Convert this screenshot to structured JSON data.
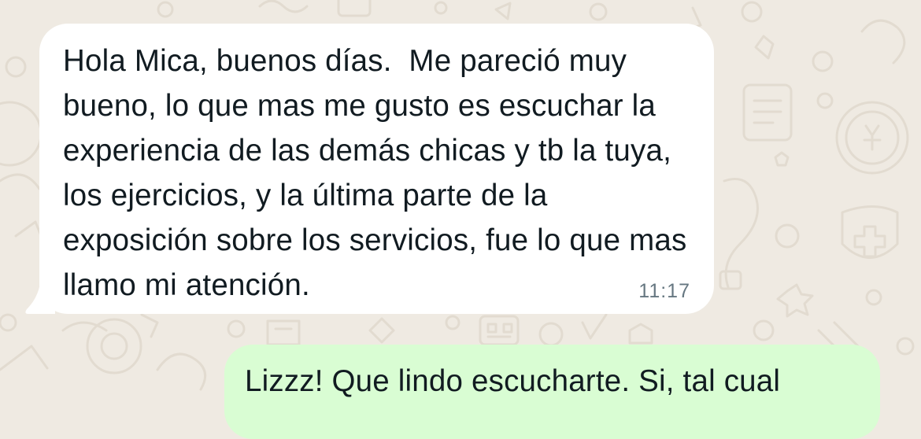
{
  "messages": [
    {
      "direction": "incoming",
      "text": "Hola Mica, buenos días.  Me pareció muy bueno, lo que mas me gusto es escuchar la experiencia de las demás chicas y tb la tuya, los ejercicios, y la última parte de la exposición sobre los servicios, fue lo que mas llamo mi atención.",
      "time": "11:17"
    },
    {
      "direction": "outgoing",
      "text": "Lizzz! Que lindo escucharte. Si, tal cual"
    }
  ],
  "colors": {
    "wallpaper": "#efeae2",
    "incoming_bubble": "#ffffff",
    "outgoing_bubble": "#d9fdd3",
    "text": "#111b21",
    "timestamp": "#667781"
  }
}
